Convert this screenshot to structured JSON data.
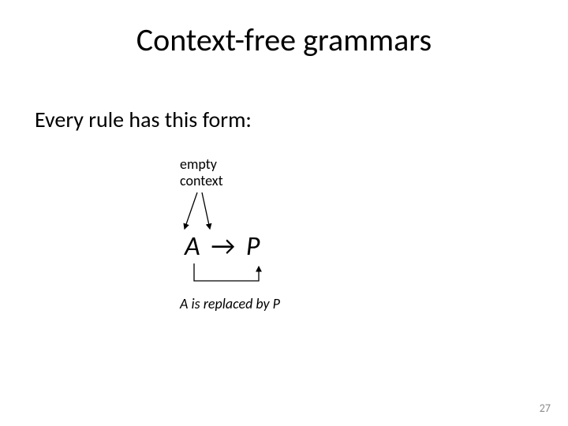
{
  "title": "Context-free grammars",
  "body": "Every rule has this form:",
  "annotation_top_line1": "empty",
  "annotation_top_line2": "context",
  "formula_lhs": "A",
  "formula_arrow": "→",
  "formula_rhs": "P",
  "caption": "A is replaced by P",
  "page_number": "27"
}
